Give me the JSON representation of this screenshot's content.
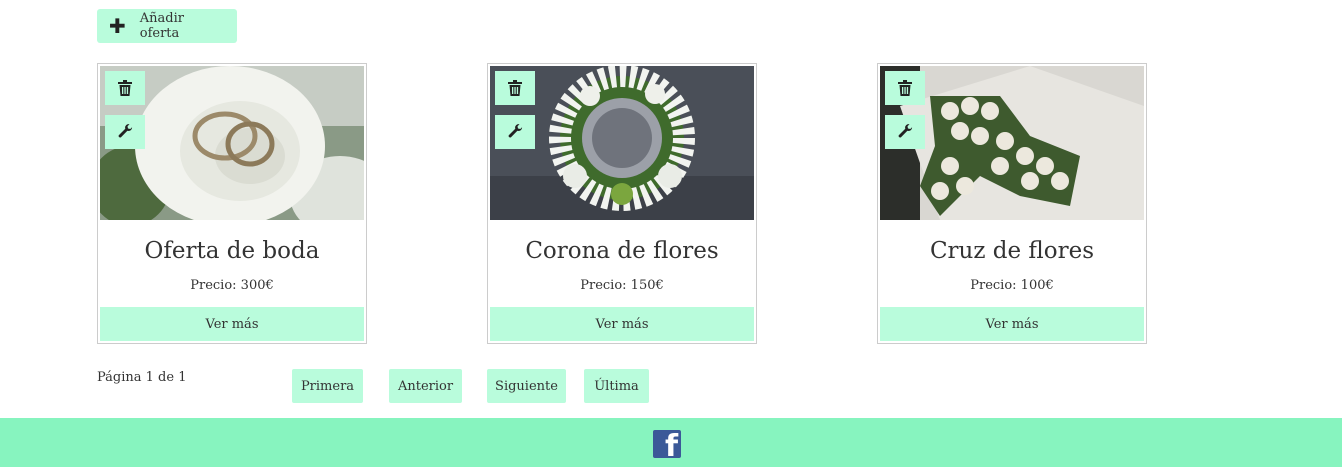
{
  "toolbar": {
    "add_label": "Añadir oferta",
    "add_icon": "plus-icon"
  },
  "offers": [
    {
      "title": "Oferta de boda",
      "price": "Precio: 300€",
      "more_label": "Ver más",
      "image": "wedding-rings-white-rose"
    },
    {
      "title": "Corona de flores",
      "price": "Precio: 150€",
      "more_label": "Ver más",
      "image": "white-flower-wreath"
    },
    {
      "title": "Cruz de flores",
      "price": "Precio: 100€",
      "more_label": "Ver más",
      "image": "white-rose-cross"
    }
  ],
  "card_icons": {
    "delete": "trash-icon",
    "edit": "wrench-icon"
  },
  "pagination": {
    "info": "Página 1 de 1",
    "first": "Primera",
    "prev": "Anterior",
    "next": "Siguiente",
    "last": "Última"
  },
  "footer": {
    "social_icon": "facebook-icon",
    "social_glyph": "f"
  },
  "colors": {
    "accent": "#b9fcdc",
    "footer": "#87f4bf",
    "facebook": "#3b5998"
  }
}
